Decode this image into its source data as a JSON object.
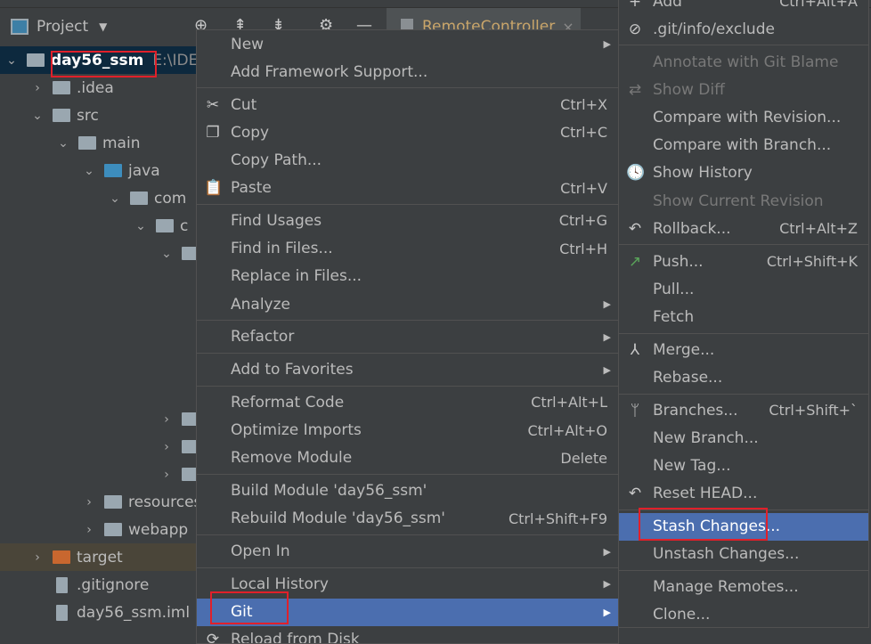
{
  "project_header": {
    "title": "Project",
    "icons": [
      "locate-icon",
      "collapse-all-icon",
      "expand-all-icon",
      "gear-icon",
      "minimize-icon"
    ]
  },
  "editor_tab": {
    "label": "RemoteController",
    "close": "×"
  },
  "tree": [
    {
      "label": "day56_ssm",
      "suffix": "E:\\IDE",
      "depth": 0,
      "expanded": true,
      "type": "module",
      "selected": true
    },
    {
      "label": ".idea",
      "depth": 1,
      "expanded": false,
      "type": "folder"
    },
    {
      "label": "src",
      "depth": 1,
      "expanded": true,
      "type": "folder"
    },
    {
      "label": "main",
      "depth": 2,
      "expanded": true,
      "type": "folder"
    },
    {
      "label": "java",
      "depth": 3,
      "expanded": true,
      "type": "source-folder"
    },
    {
      "label": "com",
      "depth": 4,
      "expanded": true,
      "type": "package"
    },
    {
      "label": "c",
      "depth": 5,
      "expanded": true,
      "type": "package"
    },
    {
      "label": "",
      "depth": 6,
      "expanded": true,
      "type": "package"
    },
    {
      "label": "",
      "depth": 6,
      "expanded": false,
      "type": "package",
      "row": 13
    },
    {
      "label": "",
      "depth": 6,
      "expanded": false,
      "type": "package",
      "row": 14
    },
    {
      "label": "",
      "depth": 6,
      "expanded": false,
      "type": "package",
      "row": 15
    },
    {
      "label": "resources",
      "depth": 3,
      "expanded": false,
      "type": "resources-folder",
      "row": 16
    },
    {
      "label": "webapp",
      "depth": 3,
      "expanded": false,
      "type": "folder",
      "row": 17
    },
    {
      "label": "target",
      "depth": 1,
      "expanded": false,
      "type": "excluded-folder",
      "row": 18
    },
    {
      "label": ".gitignore",
      "depth": 1,
      "type": "ignore-file",
      "row": 19
    },
    {
      "label": "day56_ssm.iml",
      "depth": 1,
      "type": "iml-file",
      "row": 20
    }
  ],
  "context_menu": [
    {
      "label": "New",
      "submenu": true
    },
    {
      "label": "Add Framework Support..."
    },
    {
      "sep": true
    },
    {
      "label": "Cut",
      "shortcut": "Ctrl+X",
      "icon": "scissors-icon",
      "glyph": "✂"
    },
    {
      "label": "Copy",
      "shortcut": "Ctrl+C",
      "icon": "copy-icon",
      "glyph": "❐"
    },
    {
      "label": "Copy Path..."
    },
    {
      "label": "Paste",
      "shortcut": "Ctrl+V",
      "icon": "paste-icon",
      "glyph": "📋"
    },
    {
      "sep": true
    },
    {
      "label": "Find Usages",
      "shortcut": "Ctrl+G"
    },
    {
      "label": "Find in Files...",
      "shortcut": "Ctrl+H"
    },
    {
      "label": "Replace in Files..."
    },
    {
      "label": "Analyze",
      "submenu": true
    },
    {
      "sep": true
    },
    {
      "label": "Refactor",
      "submenu": true
    },
    {
      "sep": true
    },
    {
      "label": "Add to Favorites",
      "submenu": true
    },
    {
      "sep": true
    },
    {
      "label": "Reformat Code",
      "shortcut": "Ctrl+Alt+L"
    },
    {
      "label": "Optimize Imports",
      "shortcut": "Ctrl+Alt+O"
    },
    {
      "label": "Remove Module",
      "shortcut": "Delete"
    },
    {
      "sep": true
    },
    {
      "label": "Build Module 'day56_ssm'"
    },
    {
      "label": "Rebuild Module 'day56_ssm'",
      "shortcut": "Ctrl+Shift+F9"
    },
    {
      "sep": true
    },
    {
      "label": "Open In",
      "submenu": true
    },
    {
      "sep": true
    },
    {
      "label": "Local History",
      "submenu": true
    },
    {
      "label": "Git",
      "submenu": true,
      "highlighted": true
    },
    {
      "label": "Reload from Disk",
      "icon": "reload-icon",
      "glyph": "⟳"
    }
  ],
  "git_submenu": [
    {
      "label": "Add",
      "shortcut": "Ctrl+Alt+A",
      "icon": "plus-icon",
      "glyph": "+"
    },
    {
      "label": ".git/info/exclude",
      "icon": "ignore-file-icon",
      "glyph": "⊘"
    },
    {
      "sep": true
    },
    {
      "label": "Annotate with Git Blame",
      "disabled": true
    },
    {
      "label": "Show Diff",
      "disabled": true,
      "icon": "diff-icon",
      "glyph": "⇄"
    },
    {
      "label": "Compare with Revision..."
    },
    {
      "label": "Compare with Branch..."
    },
    {
      "label": "Show History",
      "icon": "history-icon",
      "glyph": "🕓"
    },
    {
      "label": "Show Current Revision",
      "disabled": true
    },
    {
      "label": "Rollback...",
      "shortcut": "Ctrl+Alt+Z",
      "icon": "rollback-icon",
      "glyph": "↶"
    },
    {
      "sep": true
    },
    {
      "label": "Push...",
      "shortcut": "Ctrl+Shift+K",
      "icon": "push-arrow-icon",
      "glyph": "↗",
      "color": "#5aa55a"
    },
    {
      "label": "Pull..."
    },
    {
      "label": "Fetch"
    },
    {
      "sep": true
    },
    {
      "label": "Merge...",
      "icon": "merge-icon",
      "glyph": "⅄"
    },
    {
      "label": "Rebase..."
    },
    {
      "sep": true
    },
    {
      "label": "Branches...",
      "shortcut": "Ctrl+Shift+`",
      "icon": "branch-icon",
      "glyph": "ᛘ"
    },
    {
      "label": "New Branch..."
    },
    {
      "label": "New Tag..."
    },
    {
      "label": "Reset HEAD...",
      "icon": "reset-icon",
      "glyph": "↶"
    },
    {
      "sep": true
    },
    {
      "label": "Stash Changes...",
      "highlighted": true
    },
    {
      "label": "Unstash Changes..."
    },
    {
      "sep": true
    },
    {
      "label": "Manage Remotes..."
    },
    {
      "label": "Clone..."
    }
  ],
  "colors": {
    "highlight": "#4b6eaf",
    "annotation_box": "#e0202a",
    "selected_row": "#0d293e"
  }
}
